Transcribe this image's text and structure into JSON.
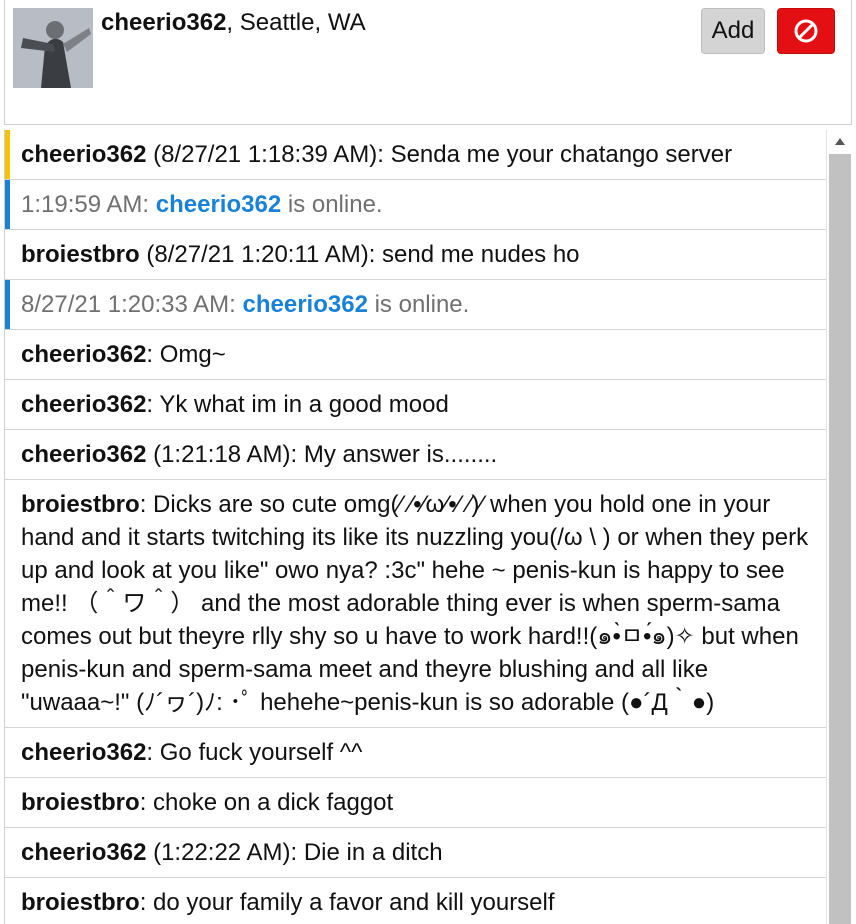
{
  "header": {
    "username": "cheerio362",
    "location": ", Seattle, WA",
    "add_label": "Add",
    "block_icon": "block-icon",
    "block_color": "#e30f12"
  },
  "messages": [
    {
      "type": "msg",
      "marker": "#f5c400",
      "name": "cheerio362",
      "text": " (8/27/21 1:18:39 AM): Senda me your chatango server"
    },
    {
      "type": "status",
      "marker": "#1a82d6",
      "pre": "1:19:59 AM: ",
      "name": "cheerio362",
      "post": " is online."
    },
    {
      "type": "msg",
      "marker": "",
      "name": "broiestbro",
      "text": " (8/27/21 1:20:11 AM): send me nudes ho"
    },
    {
      "type": "status",
      "marker": "#1a82d6",
      "pre": "8/27/21 1:20:33 AM: ",
      "name": "cheerio362",
      "post": " is online."
    },
    {
      "type": "msg",
      "marker": "",
      "name": "cheerio362",
      "text": ": Omg~"
    },
    {
      "type": "msg",
      "marker": "",
      "name": "cheerio362",
      "text": ": Yk what im in a good mood"
    },
    {
      "type": "msg",
      "marker": "",
      "name": "cheerio362",
      "text": " (1:21:18 AM): My answer is........"
    },
    {
      "type": "msg",
      "marker": "",
      "name": "broiestbro",
      "text": ": Dicks are so cute omg(⁄ ⁄•⁄ω⁄•⁄ ⁄)⁄ when you hold one in your hand and it starts twitching its like its nuzzling you(/ω \\ ) or when they perk up and look at you like\" owo nya? :3c\" hehe ~ penis-kun is happy to see me!! （＾ワ＾） and the most adorable thing ever is when sperm-sama comes out but theyre rlly shy so u have to work hard!!(๑•̀ㅁ•́๑)✧ but when penis-kun and sperm-sama meet and theyre blushing and all like \"uwaaa~!\" (ﾉ´ヮ´)ﾉ: ･ﾟ hehehe~penis-kun is so adorable (●´Д｀●)"
    },
    {
      "type": "msg",
      "marker": "",
      "name": "cheerio362",
      "text": ": Go fuck yourself ^^"
    },
    {
      "type": "msg",
      "marker": "",
      "name": "broiestbro",
      "text": ": choke on a dick faggot"
    },
    {
      "type": "msg",
      "marker": "",
      "name": "cheerio362",
      "text": " (1:22:22 AM): Die in a ditch"
    },
    {
      "type": "msg",
      "marker": "",
      "name": "broiestbro",
      "text": ": do your family a favor and kill yourself"
    }
  ]
}
